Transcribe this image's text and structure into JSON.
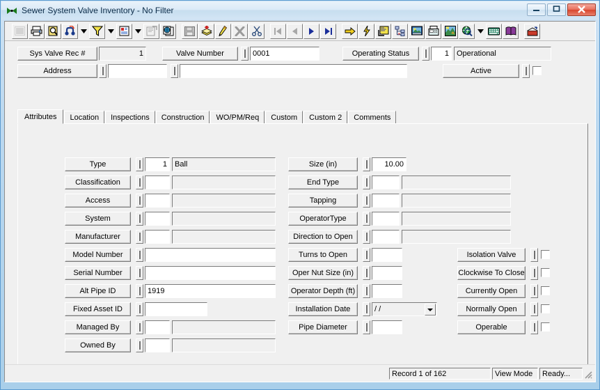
{
  "window": {
    "title": "Sewer System Valve Inventory - No Filter",
    "icon": "bowtie-app-icon",
    "buttons": {
      "minimize": "minimize-icon",
      "maximize": "maximize-icon",
      "close": "close-icon"
    }
  },
  "toolbar": {
    "groups": [
      {
        "buttons": [
          {
            "name": "grid-view-button",
            "icon": "grid-icon",
            "enabled": false
          },
          {
            "name": "print-button",
            "icon": "printer-icon",
            "enabled": true
          },
          {
            "name": "print-preview-button",
            "icon": "magnifier-page-icon",
            "enabled": true
          },
          {
            "name": "find-button",
            "icon": "binoculars-icon",
            "enabled": true
          },
          {
            "name": "find-dropdown",
            "icon": "chevron-down-icon",
            "enabled": true
          },
          {
            "name": "filter-button",
            "icon": "funnel-icon",
            "enabled": true
          },
          {
            "name": "filter-dropdown",
            "icon": "chevron-down-icon",
            "enabled": true
          },
          {
            "name": "report-button",
            "icon": "report-page-icon",
            "enabled": true
          },
          {
            "name": "report-dropdown",
            "icon": "chevron-down-icon",
            "enabled": true
          },
          {
            "name": "properties-button",
            "icon": "properties-icon",
            "enabled": false
          },
          {
            "name": "copy-record-button",
            "icon": "copy-pages-icon",
            "enabled": true
          }
        ]
      },
      {
        "buttons": [
          {
            "name": "save-button",
            "icon": "floppy-disk-icon",
            "enabled": false
          },
          {
            "name": "new-record-button",
            "icon": "new-stack-icon",
            "enabled": true
          },
          {
            "name": "edit-button",
            "icon": "pencil-icon",
            "enabled": true
          },
          {
            "name": "delete-button",
            "icon": "x-delete-icon",
            "enabled": false
          },
          {
            "name": "cut-button",
            "icon": "scissors-icon",
            "enabled": true
          }
        ]
      },
      {
        "buttons": [
          {
            "name": "first-record-button",
            "icon": "first-record-icon",
            "enabled": false
          },
          {
            "name": "previous-record-button",
            "icon": "previous-record-icon",
            "enabled": false
          },
          {
            "name": "next-record-button",
            "icon": "next-record-icon",
            "enabled": true
          },
          {
            "name": "last-record-button",
            "icon": "last-record-icon",
            "enabled": true
          }
        ]
      },
      {
        "buttons": [
          {
            "name": "goto-button",
            "icon": "yellow-arrow-icon",
            "enabled": true
          },
          {
            "name": "quick-action-button",
            "icon": "lightning-bolt-icon",
            "enabled": true
          },
          {
            "name": "map-button",
            "icon": "map-window-icon",
            "enabled": true
          },
          {
            "name": "hierarchy-button",
            "icon": "tree-nodes-icon",
            "enabled": true
          },
          {
            "name": "image-button",
            "icon": "picture-icon",
            "enabled": true
          },
          {
            "name": "fax-button",
            "icon": "fax-machine-icon",
            "enabled": true
          },
          {
            "name": "gis-button",
            "icon": "gis-map-icon",
            "enabled": true
          },
          {
            "name": "internet-button",
            "icon": "globe-magnifier-icon",
            "enabled": true
          },
          {
            "name": "internet-dropdown",
            "icon": "chevron-down-icon",
            "enabled": true
          },
          {
            "name": "keyboard-button",
            "icon": "keyboard-icon",
            "enabled": true
          },
          {
            "name": "help-button",
            "icon": "book-icon",
            "enabled": true
          }
        ]
      },
      {
        "buttons": [
          {
            "name": "exit-button",
            "icon": "exit-door-icon",
            "enabled": true
          }
        ]
      }
    ]
  },
  "header": {
    "sys_valve_rec": {
      "label": "Sys Valve Rec #",
      "value": "1"
    },
    "valve_number": {
      "label": "Valve Number",
      "value": "0001"
    },
    "operating_status": {
      "label": "Operating Status",
      "code": "1",
      "description": "Operational"
    },
    "address": {
      "label": "Address",
      "value": "",
      "value2": ""
    },
    "active": {
      "label": "Active",
      "checked": false
    }
  },
  "tabs": [
    {
      "label": "Attributes",
      "active": true
    },
    {
      "label": "Location",
      "active": false
    },
    {
      "label": "Inspections",
      "active": false
    },
    {
      "label": "Construction",
      "active": false
    },
    {
      "label": "WO/PM/Req",
      "active": false
    },
    {
      "label": "Custom",
      "active": false
    },
    {
      "label": "Custom 2",
      "active": false
    },
    {
      "label": "Comments",
      "active": false
    }
  ],
  "attributes": {
    "left_column": [
      {
        "label": "Type",
        "code": "1",
        "description": "Ball",
        "kind": "code-desc"
      },
      {
        "label": "Classification",
        "code": "",
        "description": "",
        "kind": "code-desc"
      },
      {
        "label": "Access",
        "code": "",
        "description": "",
        "kind": "code-desc"
      },
      {
        "label": "System",
        "code": "",
        "description": "",
        "kind": "code-desc"
      },
      {
        "label": "Manufacturer",
        "code": "",
        "description": "",
        "kind": "code-desc"
      },
      {
        "label": "Model Number",
        "value": "",
        "kind": "text-wide"
      },
      {
        "label": "Serial Number",
        "value": "",
        "kind": "text-wide"
      },
      {
        "label": "Alt Pipe ID",
        "value": "1919",
        "kind": "text-wide"
      },
      {
        "label": "Fixed Asset ID",
        "value": "",
        "kind": "text-medium"
      },
      {
        "label": "Managed By",
        "code": "",
        "description": "",
        "kind": "code-desc"
      },
      {
        "label": "Owned By",
        "code": "",
        "description": "",
        "kind": "code-desc"
      }
    ],
    "middle_column": [
      {
        "label": "Size (in)",
        "value": "10.00",
        "kind": "number"
      },
      {
        "label": "End Type",
        "code": "",
        "description": "",
        "kind": "code-desc"
      },
      {
        "label": "Tapping",
        "code": "",
        "description": "",
        "kind": "code-desc"
      },
      {
        "label": "OperatorType",
        "code": "",
        "description": "",
        "kind": "code-desc"
      },
      {
        "label": "Direction to Open",
        "code": "",
        "description": "",
        "kind": "code-desc"
      },
      {
        "label": "Turns to Open",
        "value": "",
        "kind": "number"
      },
      {
        "label": "Oper Nut Size (in)",
        "value": "",
        "kind": "number"
      },
      {
        "label": "Operator Depth (ft)",
        "value": "",
        "kind": "number"
      },
      {
        "label": "Installation Date",
        "value": "/  /",
        "kind": "date"
      },
      {
        "label": "Pipe Diameter",
        "value": "",
        "kind": "number"
      }
    ],
    "right_column": [
      {
        "label": "Isolation Valve",
        "checked": false
      },
      {
        "label": "Clockwise To Close",
        "checked": false
      },
      {
        "label": "Currently Open",
        "checked": false
      },
      {
        "label": "Normally Open",
        "checked": false
      },
      {
        "label": "Operable",
        "checked": false
      }
    ]
  },
  "statusbar": {
    "record": "Record 1 of 162",
    "mode": "View Mode",
    "state": "Ready...",
    "grip": "resize-grip-icon"
  },
  "colors": {
    "window_frame": "#5b9bd0",
    "client": "#f0f0f0",
    "field_border": "#7b7b7b",
    "close_button": "#d8452d"
  }
}
